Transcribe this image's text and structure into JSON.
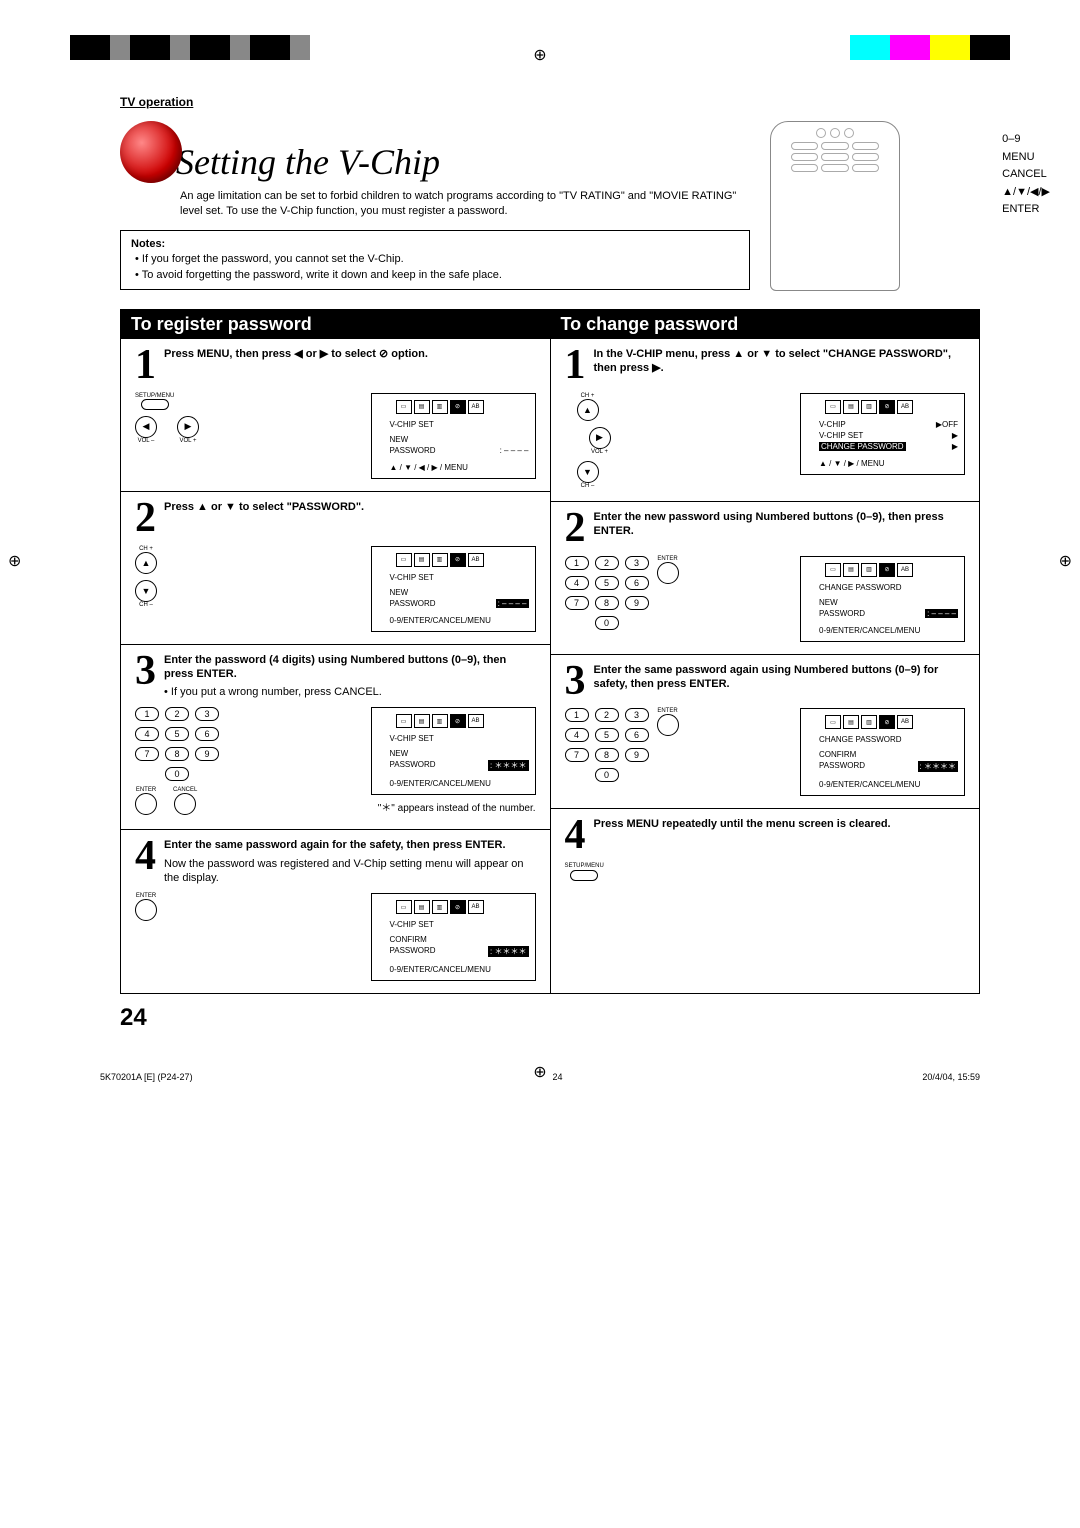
{
  "header": {
    "section": "TV operation"
  },
  "title": "Setting the V-Chip",
  "intro": "An age limitation can be set to forbid children to watch programs according to \"TV RATING\" and \"MOVIE RATING\" level set. To use the V-Chip function, you must register a password.",
  "notes": {
    "head": "Notes:",
    "items": [
      "If you forget the password, you cannot set the V-Chip.",
      "To avoid forgetting the password, write it down and keep in the safe place."
    ]
  },
  "remote_labels": {
    "l1": "0–9",
    "l2": "MENU",
    "l3": "CANCEL",
    "l4": "▲/▼/◀/▶",
    "l5": "ENTER"
  },
  "colA": {
    "head": "To register password",
    "step1": {
      "text": "Press MENU, then press ◀ or ▶ to select ⊘ option.",
      "btn_setup": "SETUP/MENU",
      "btn_voll": "VOL –",
      "btn_volr": "VOL +",
      "osd": {
        "title": "V-CHIP SET",
        "line1a": "NEW",
        "line1b": "PASSWORD",
        "line1c": ": – – – –",
        "hint": "▲ / ▼ / ◀ / ▶ / MENU"
      }
    },
    "step2": {
      "text": "Press ▲ or ▼ to select \"PASSWORD\".",
      "btn_chup": "CH +",
      "btn_chdn": "CH –",
      "osd": {
        "title": "V-CHIP SET",
        "line1a": "NEW",
        "line1b": "PASSWORD",
        "line1c": ": – – – –",
        "hint": "0-9/ENTER/CANCEL/MENU"
      }
    },
    "step3": {
      "text": "Enter the password (4 digits) using Numbered buttons (0–9), then press ENTER.",
      "sub": "If you put a wrong number, press CANCEL.",
      "btn_enter": "ENTER",
      "btn_cancel": "CANCEL",
      "osd": {
        "title": "V-CHIP SET",
        "line1a": "NEW",
        "line1b": "PASSWORD",
        "line1c": ": ＊＊＊＊",
        "hint": "0-9/ENTER/CANCEL/MENU"
      },
      "star": "\"＊\" appears instead of the number."
    },
    "step4": {
      "text": "Enter the same password again for the safety, then press ENTER.",
      "sub": "Now the password was registered and V-Chip setting menu will appear on the display.",
      "btn_enter": "ENTER",
      "osd": {
        "title": "V-CHIP SET",
        "line1a": "CONFIRM",
        "line1b": "PASSWORD",
        "line1c": ": ＊＊＊＊",
        "hint": "0-9/ENTER/CANCEL/MENU"
      }
    }
  },
  "colB": {
    "head": "To change password",
    "step1": {
      "text": "In the V-CHIP menu, press ▲ or ▼ to select \"CHANGE PASSWORD\", then press ▶.",
      "btn_chup": "CH +",
      "btn_chdn": "CH –",
      "btn_volr": "VOL +",
      "osd": {
        "l1a": "V-CHIP",
        "l1b": "▶OFF",
        "l2a": "V-CHIP SET",
        "l2b": "▶",
        "l3a": "CHANGE PASSWORD",
        "l3b": "▶",
        "hint": "▲ / ▼ / ▶ / MENU"
      }
    },
    "step2": {
      "text": "Enter the new password using Numbered buttons (0–9), then press ENTER.",
      "btn_enter": "ENTER",
      "osd": {
        "title": "CHANGE  PASSWORD",
        "line1a": "NEW",
        "line1b": "PASSWORD",
        "line1c": ": – – – –",
        "hint": "0-9/ENTER/CANCEL/MENU"
      }
    },
    "step3": {
      "text": "Enter the same password again using Numbered buttons (0–9) for safety, then press ENTER.",
      "btn_enter": "ENTER",
      "osd": {
        "title": "CHANGE  PASSWORD",
        "line1a": "CONFIRM",
        "line1b": "PASSWORD",
        "line1c": ": ＊＊＊＊",
        "hint": "0-9/ENTER/CANCEL/MENU"
      }
    },
    "step4": {
      "text": "Press MENU repeatedly until the menu screen is cleared.",
      "btn_setup": "SETUP/MENU"
    }
  },
  "numpad": [
    "1",
    "2",
    "3",
    "4",
    "5",
    "6",
    "7",
    "8",
    "9",
    "0"
  ],
  "page_num": "24",
  "footer": {
    "left": "5K70201A [E] (P24-27)",
    "center": "24",
    "right": "20/4/04, 15:59"
  }
}
